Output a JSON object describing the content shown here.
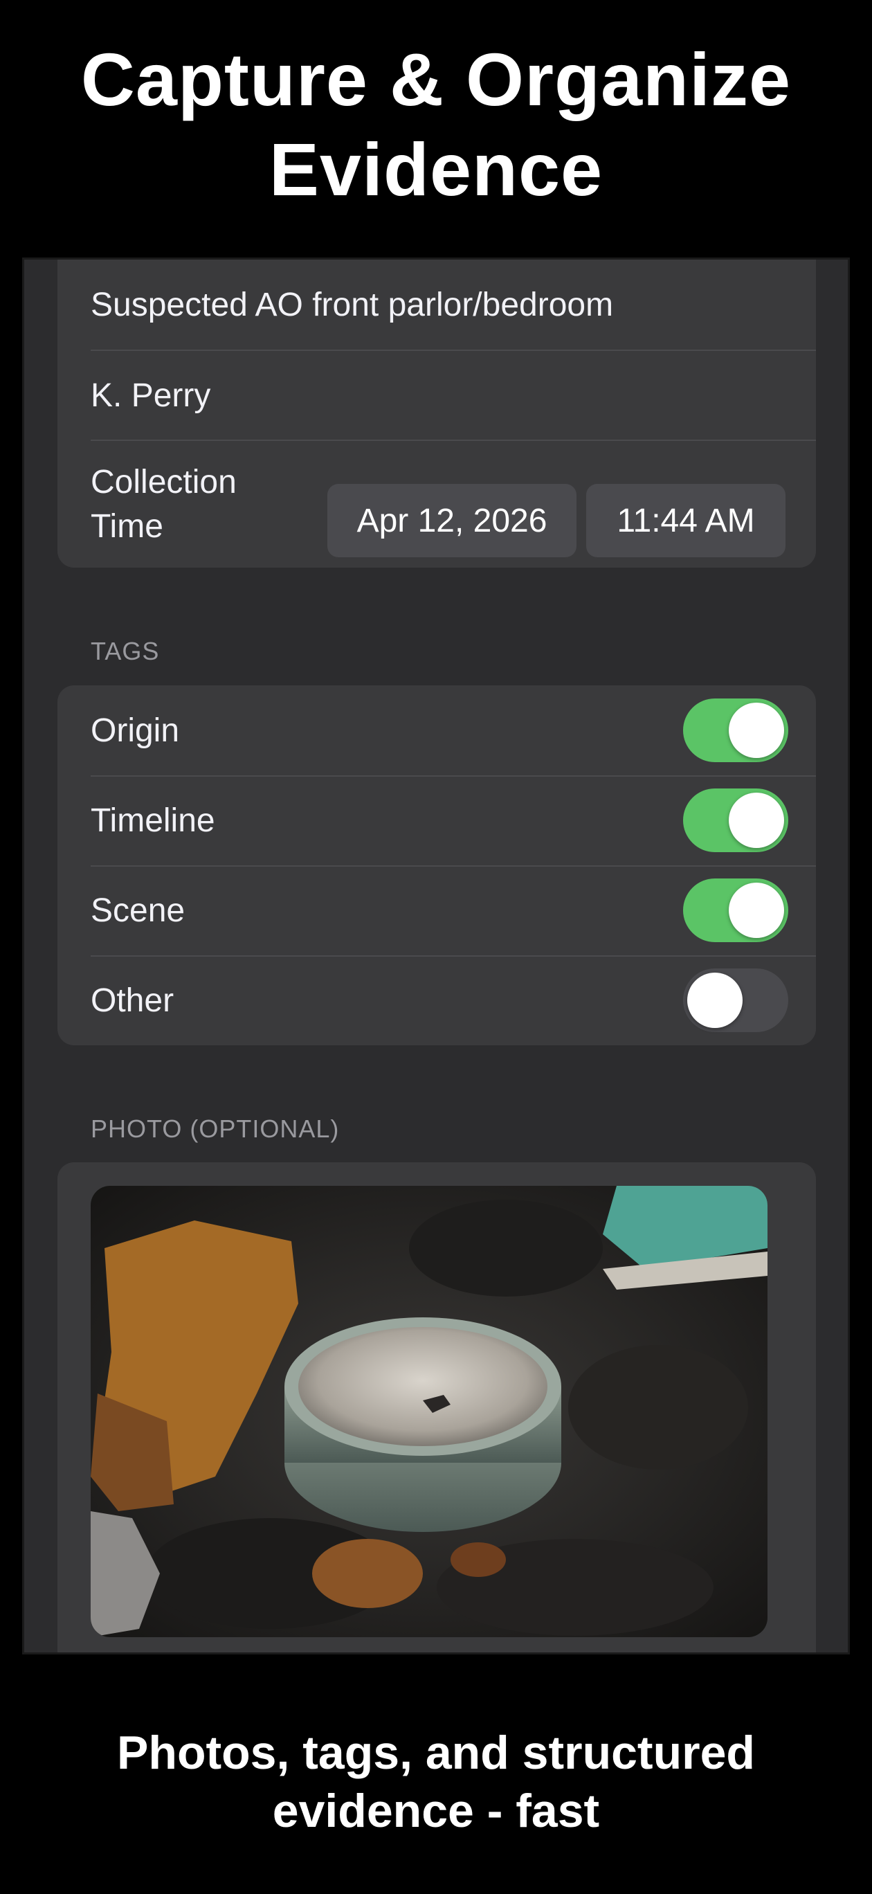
{
  "headline": {
    "line1": "Capture & Organize",
    "line2": "Evidence"
  },
  "details": {
    "location": "Suspected AO front parlor/bedroom",
    "collector": "K. Perry",
    "collection_time_label_line1": "Collection",
    "collection_time_label_line2": "Time",
    "date": "Apr 12, 2026",
    "time": "11:44 AM"
  },
  "tags": {
    "header": "TAGS",
    "items": [
      {
        "label": "Origin",
        "on": true
      },
      {
        "label": "Timeline",
        "on": true
      },
      {
        "label": "Scene",
        "on": true
      },
      {
        "label": "Other",
        "on": false
      }
    ]
  },
  "photo": {
    "header": "PHOTO (OPTIONAL)",
    "description": "evidence-photo-charred-debris"
  },
  "tagline": {
    "line1": "Photos, tags, and structured",
    "line2": "evidence - fast"
  },
  "colors": {
    "toggle_on": "#5bc466",
    "card": "#3a3a3c",
    "screen": "#2c2c2e"
  }
}
